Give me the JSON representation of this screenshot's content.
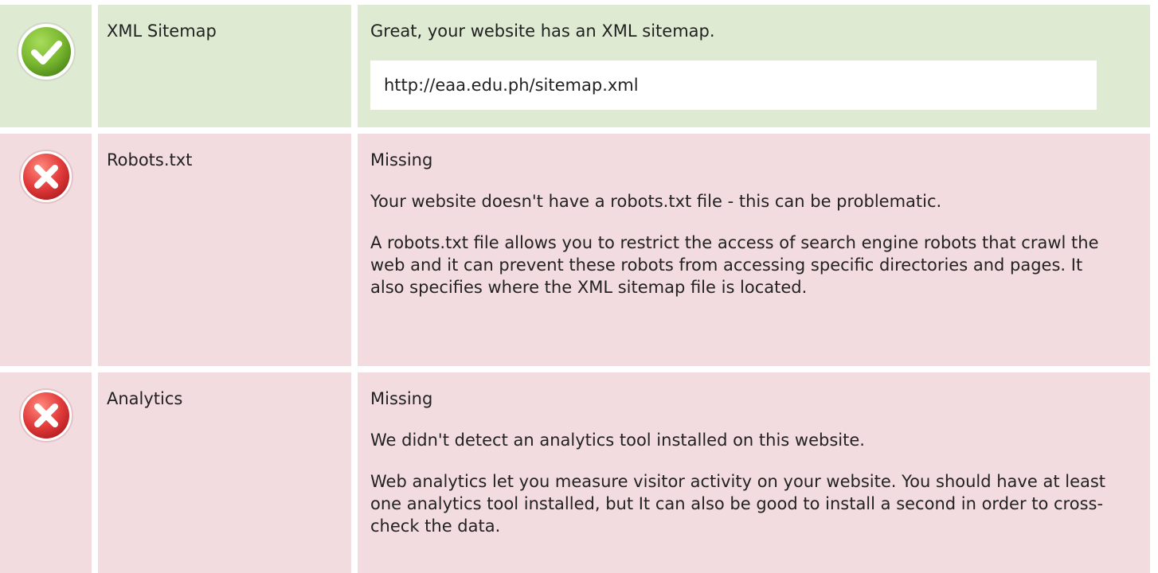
{
  "colors": {
    "pass_background": "#dfead3",
    "fail_background": "#f2dcdf",
    "pass_icon": "#7ab830",
    "fail_icon": "#e23b3b"
  },
  "checks": [
    {
      "status": "pass",
      "icon": "check-circle-icon",
      "label": "XML Sitemap",
      "message": "Great, your website has an XML sitemap.",
      "url": "http://eaa.edu.ph/sitemap.xml"
    },
    {
      "status": "fail",
      "icon": "cross-circle-icon",
      "label": "Robots.txt",
      "state": "Missing",
      "summary": "Your website doesn't have a robots.txt file - this can be problematic.",
      "description": "A robots.txt file allows you to restrict the access of search engine robots that crawl the web and it can prevent these robots from accessing specific directories and pages. It also specifies where the XML sitemap file is located."
    },
    {
      "status": "fail",
      "icon": "cross-circle-icon",
      "label": "Analytics",
      "state": "Missing",
      "summary": "We didn't detect an analytics tool installed on this website.",
      "description": "Web analytics let you measure visitor activity on your website. You should have at least one analytics tool installed, but It can also be good to install a second in order to cross-check the data."
    }
  ]
}
